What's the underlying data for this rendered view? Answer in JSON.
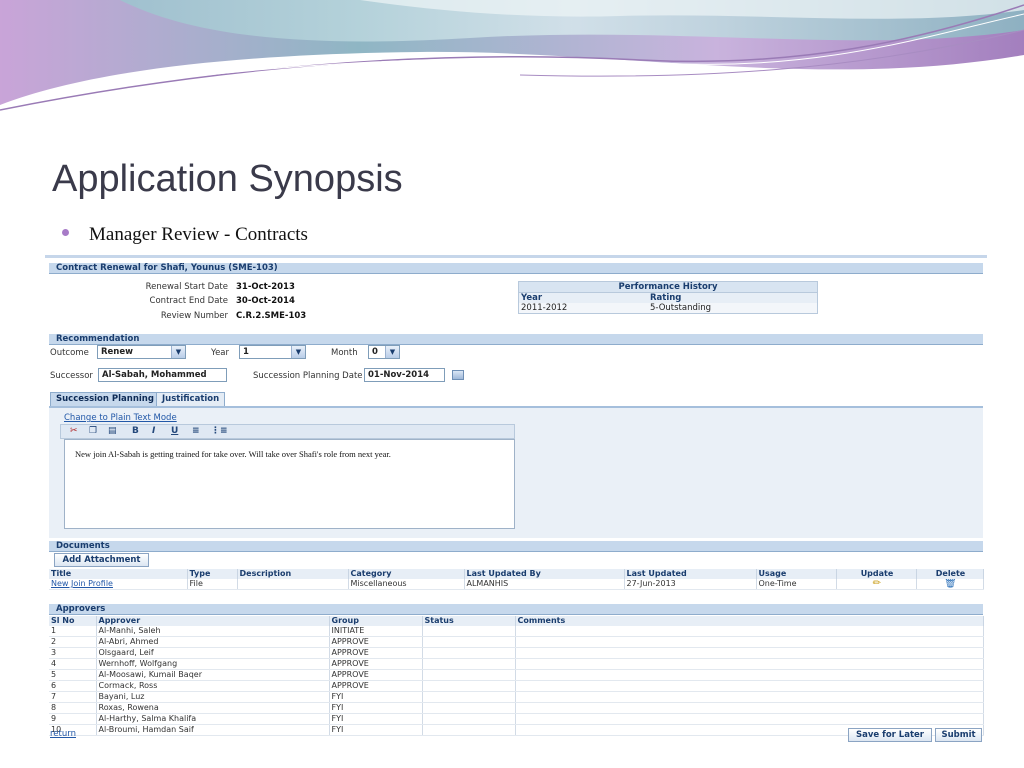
{
  "slide": {
    "title": "Application Synopsis",
    "bullet": "Manager Review - Contracts"
  },
  "contract": {
    "header": "Contract Renewal for Shafi, Younus (SME-103)",
    "fields": [
      {
        "label": "Renewal Start Date",
        "value": "31-Oct-2013"
      },
      {
        "label": "Contract End Date",
        "value": "30-Oct-2014"
      },
      {
        "label": "Review Number",
        "value": "C.R.2.SME-103"
      }
    ],
    "performance": {
      "title": "Performance History",
      "col_year": "Year",
      "col_rating": "Rating",
      "rows": [
        {
          "year": "2011-2012",
          "rating": "5-Outstanding"
        }
      ]
    }
  },
  "recommendation": {
    "header": "Recommendation",
    "outcome_label": "Outcome",
    "outcome_value": "Renew",
    "year_label": "Year",
    "year_value": "1",
    "month_label": "Month",
    "month_value": "0",
    "successor_label": "Successor",
    "successor_value": "Al-Sabah, Mohammed",
    "spd_label": "Succession Planning Date",
    "spd_value": "01-Nov-2014"
  },
  "tabs": [
    {
      "label": "Succession Planning",
      "active": true
    },
    {
      "label": "Justification",
      "active": false
    }
  ],
  "editor": {
    "mode_link": "Change to Plain Text Mode",
    "text": "New join Al-Sabah is getting trained for take over. Will take over Shafi's role from next year."
  },
  "documents": {
    "header": "Documents",
    "add_button": "Add Attachment",
    "columns": [
      "Title",
      "Type",
      "Description",
      "Category",
      "Last Updated By",
      "Last Updated",
      "Usage",
      "Update",
      "Delete"
    ],
    "rows": [
      {
        "title": "New Join Profile",
        "type": "File",
        "description": "",
        "category": "Miscellaneous",
        "updated_by": "ALMANHIS",
        "updated": "27-Jun-2013",
        "usage": "One-Time"
      }
    ]
  },
  "approvers": {
    "header": "Approvers",
    "columns": [
      "Sl No",
      "Approver",
      "Group",
      "Status",
      "Comments"
    ],
    "rows": [
      {
        "no": "1",
        "name": "Al-Manhi, Saleh",
        "group": "INITIATE",
        "status": "",
        "comments": ""
      },
      {
        "no": "2",
        "name": "Al-Abri, Ahmed",
        "group": "APPROVE",
        "status": "",
        "comments": ""
      },
      {
        "no": "3",
        "name": "Olsgaard, Leif",
        "group": "APPROVE",
        "status": "",
        "comments": ""
      },
      {
        "no": "4",
        "name": "Wernhoff, Wolfgang",
        "group": "APPROVE",
        "status": "",
        "comments": ""
      },
      {
        "no": "5",
        "name": "Al-Moosawi, Kumail Baqer",
        "group": "APPROVE",
        "status": "",
        "comments": ""
      },
      {
        "no": "6",
        "name": "Cormack, Ross",
        "group": "APPROVE",
        "status": "",
        "comments": ""
      },
      {
        "no": "7",
        "name": "Bayani, Luz",
        "group": "FYI",
        "status": "",
        "comments": ""
      },
      {
        "no": "8",
        "name": "Roxas, Rowena",
        "group": "FYI",
        "status": "",
        "comments": ""
      },
      {
        "no": "9",
        "name": "Al-Harthy, Salma Khalifa",
        "group": "FYI",
        "status": "",
        "comments": ""
      },
      {
        "no": "10",
        "name": "Al-Broumi, Hamdan Saif",
        "group": "FYI",
        "status": "",
        "comments": ""
      }
    ]
  },
  "footer": {
    "return_link": "return",
    "save_later": "Save for Later",
    "submit": "Submit"
  }
}
